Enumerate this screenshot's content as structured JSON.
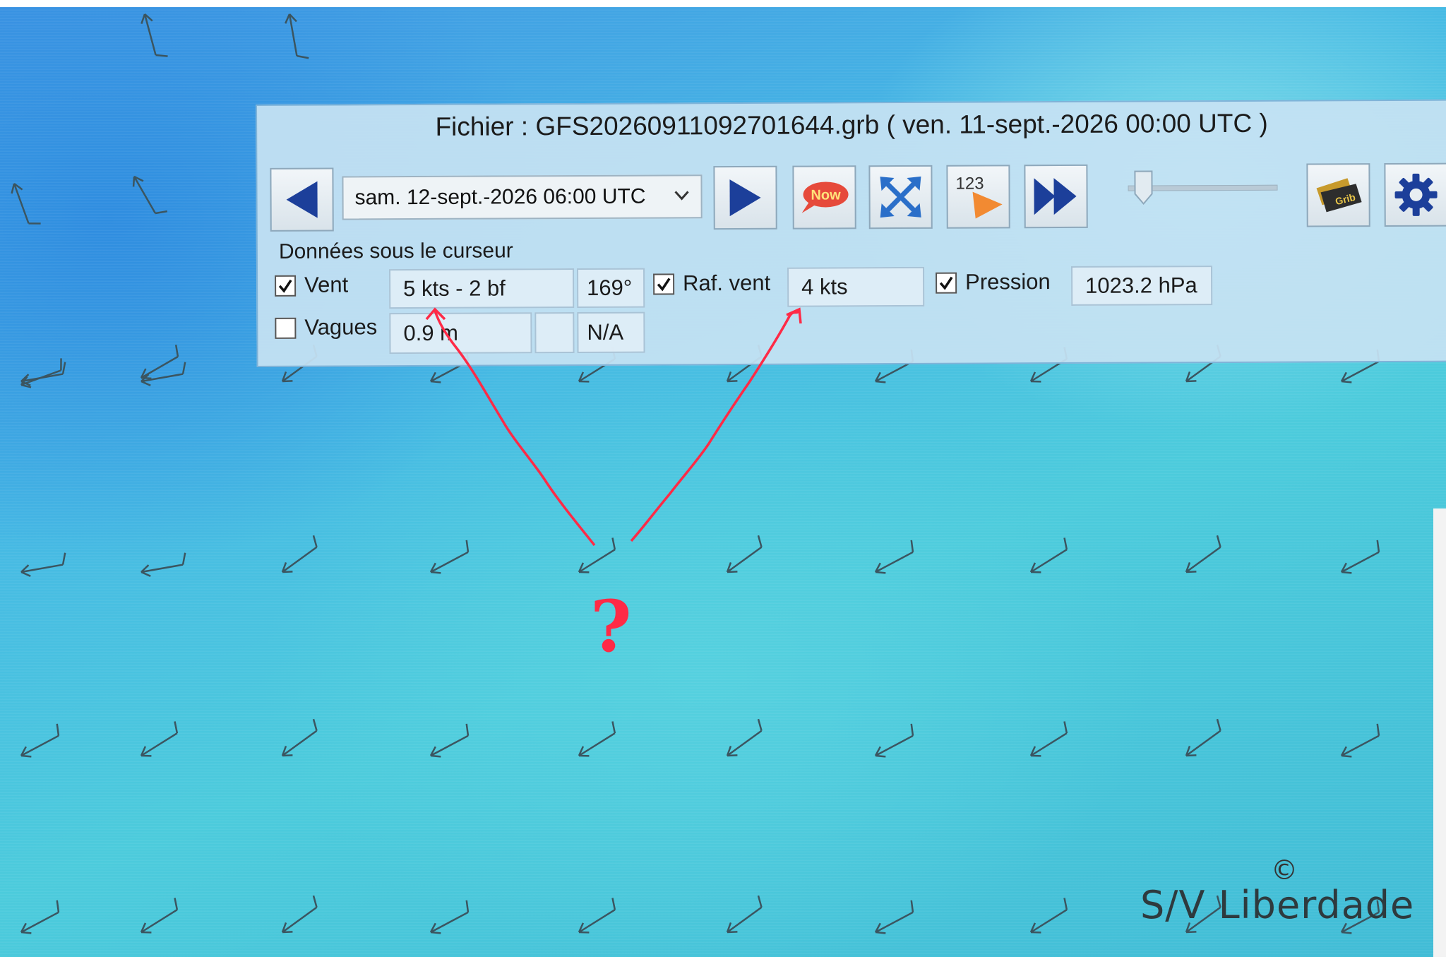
{
  "window": {
    "title": "Fichier : GFS20260911092701644.grb ( ven. 11-sept.-2026 00:00  UTC )"
  },
  "toolbar": {
    "prev_icon": "arrow-left-icon",
    "date_value": "sam. 12-sept.-2026 06:00  UTC",
    "next_icon": "arrow-right-icon",
    "now_label": "Now",
    "zoom_icon": "expand-arrows-icon",
    "numbers_label": "123",
    "fast_forward_icon": "fast-forward-icon",
    "grib_label": "Grib",
    "settings_icon": "gear-icon"
  },
  "cursor_data": {
    "section_label": "Données sous le curseur",
    "wind": {
      "label": "Vent",
      "checked": true,
      "speed": "5 kts -  2 bf",
      "direction": "169°"
    },
    "gust": {
      "label": "Raf. vent",
      "checked": true,
      "value": "4 kts"
    },
    "pressure": {
      "label": "Pression",
      "checked": true,
      "value": "1023.2 hPa"
    },
    "waves": {
      "label": "Vagues",
      "checked": false,
      "height": "0.9 m",
      "direction": "N/A"
    }
  },
  "annotation": {
    "question_mark": "?",
    "color": "#ff2a46"
  },
  "watermark": {
    "copyright_symbol": "©",
    "credit": "S/V Liberdade"
  },
  "colors": {
    "map_blue": "#3f95e4",
    "map_cyan": "#4ccbdc",
    "panel_bg": "#c6e2f3",
    "arrow_icon": "#1c3f9a"
  }
}
